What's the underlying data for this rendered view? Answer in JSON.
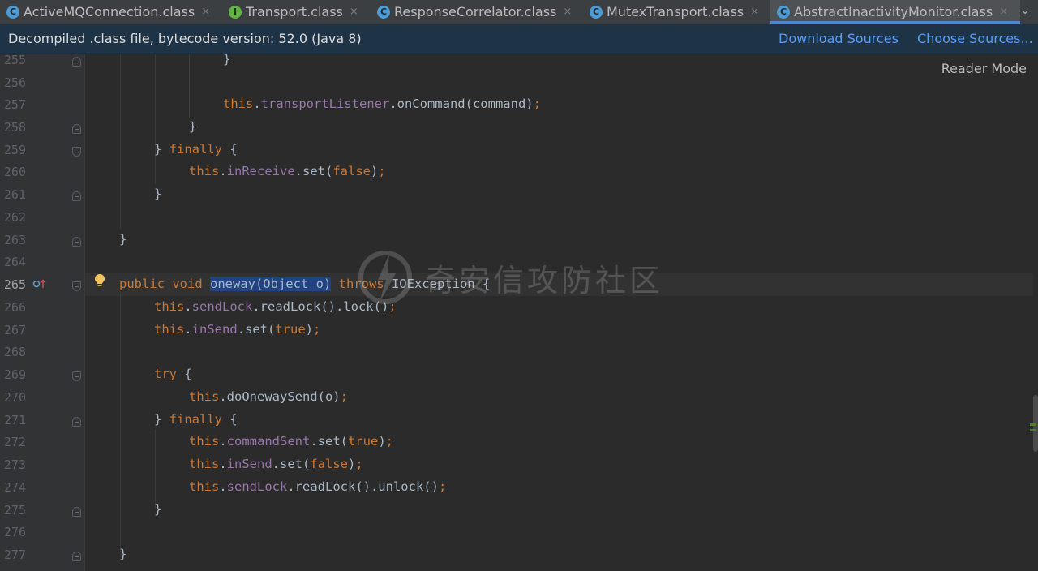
{
  "tabs": [
    {
      "label": "ActiveMQConnection.class",
      "icon": "class-icon",
      "active": false
    },
    {
      "label": "Transport.class",
      "icon": "interface-icon",
      "active": false
    },
    {
      "label": "ResponseCorrelator.class",
      "icon": "class-icon",
      "active": false
    },
    {
      "label": "MutexTransport.class",
      "icon": "class-icon",
      "active": false
    },
    {
      "label": "AbstractInactivityMonitor.class",
      "icon": "class-icon",
      "active": true
    }
  ],
  "tab_icon_letters": {
    "class": "C",
    "interface": "I"
  },
  "tab_close_glyph": "×",
  "tab_menu_glyph": "⌄",
  "banner": {
    "text": "Decompiled .class file, bytecode version: 52.0 (Java 8)",
    "download_sources": "Download Sources",
    "choose_sources": "Choose Sources..."
  },
  "reader_mode": "Reader Mode",
  "watermark": "奇安信攻防社区",
  "current_line": 265,
  "lines": [
    {
      "n": "255",
      "text": "}"
    },
    {
      "n": "256",
      "text": ""
    },
    {
      "n": "257",
      "text": "this.transportListener.onCommand(command);"
    },
    {
      "n": "258",
      "text": "}"
    },
    {
      "n": "259",
      "text": "} finally {"
    },
    {
      "n": "260",
      "text": "this.inReceive.set(false);"
    },
    {
      "n": "261",
      "text": "}"
    },
    {
      "n": "262",
      "text": ""
    },
    {
      "n": "263",
      "text": "}"
    },
    {
      "n": "264",
      "text": ""
    },
    {
      "n": "265",
      "text": "public void oneway(Object o) throws IOException {"
    },
    {
      "n": "266",
      "text": "this.sendLock.readLock().lock();"
    },
    {
      "n": "267",
      "text": "this.inSend.set(true);"
    },
    {
      "n": "268",
      "text": ""
    },
    {
      "n": "269",
      "text": "try {"
    },
    {
      "n": "270",
      "text": "this.doOnewaySend(o);"
    },
    {
      "n": "271",
      "text": "} finally {"
    },
    {
      "n": "272",
      "text": "this.commandSent.set(true);"
    },
    {
      "n": "273",
      "text": "this.inSend.set(false);"
    },
    {
      "n": "274",
      "text": "this.sendLock.readLock().unlock();"
    },
    {
      "n": "275",
      "text": "}"
    },
    {
      "n": "276",
      "text": ""
    },
    {
      "n": "277",
      "text": "}"
    }
  ],
  "colors": {
    "keyword": "#cc7832",
    "field": "#9876aa",
    "plain": "#a9b7c6",
    "selection": "#214283",
    "editor_bg": "#2b2b2b",
    "banner_bg": "#1f3347",
    "link": "#589df6"
  }
}
